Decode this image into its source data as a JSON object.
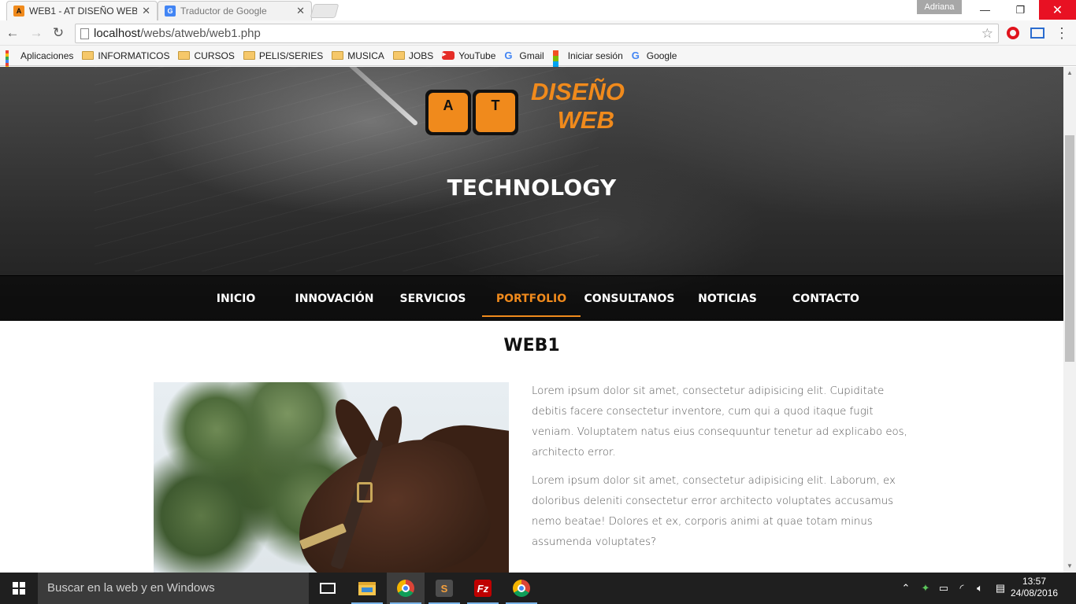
{
  "browser": {
    "tabs": [
      {
        "title": "WEB1 - AT DISEÑO WEB",
        "active": true
      },
      {
        "title": "Traductor de Google",
        "active": false
      }
    ],
    "profile_name": "Adriana",
    "url_host": "localhost",
    "url_path": "/webs/atweb/web1.php",
    "bookmarks": [
      {
        "label": "Aplicaciones",
        "icon": "apps-icon"
      },
      {
        "label": "INFORMATICOS",
        "icon": "folder-icon"
      },
      {
        "label": "CURSOS",
        "icon": "folder-icon"
      },
      {
        "label": "PELIS/SERIES",
        "icon": "folder-icon"
      },
      {
        "label": "MUSICA",
        "icon": "folder-icon"
      },
      {
        "label": "JOBS",
        "icon": "folder-icon"
      },
      {
        "label": "YouTube",
        "icon": "youtube-icon"
      },
      {
        "label": "Gmail",
        "icon": "google-icon"
      },
      {
        "label": "Iniciar sesión",
        "icon": "microsoft-icon"
      },
      {
        "label": "Google",
        "icon": "google-icon"
      }
    ]
  },
  "site": {
    "logo_key_a": "A",
    "logo_key_t": "T",
    "logo_line1": "DISEÑO",
    "logo_line2": "WEB",
    "hero_title": "TECHNOLOGY",
    "nav": [
      {
        "label": "INICIO",
        "active": false
      },
      {
        "label": "INNOVACIÓN",
        "active": false
      },
      {
        "label": "SERVICIOS",
        "active": false
      },
      {
        "label": "PORTFOLIO",
        "active": true
      },
      {
        "label": "CONSULTANOS",
        "active": false
      },
      {
        "label": "NOTICIAS",
        "active": false
      },
      {
        "label": "CONTACTO",
        "active": false
      }
    ],
    "page_title": "WEB1",
    "paragraphs": [
      "Lorem ipsum dolor sit amet, consectetur adipisicing elit. Cupiditate debitis facere consectetur inventore, cum qui a quod itaque fugit veniam. Voluptatem natus eius consequuntur tenetur ad explicabo eos, architecto error.",
      "Lorem ipsum dolor sit amet, consectetur adipisicing elit. Laborum, ex doloribus deleniti consectetur error architecto voluptates accusamus nemo beatae! Dolores et ex, corporis animi at quae totam minus assumenda voluptates?"
    ],
    "colors": {
      "accent": "#f08a1c",
      "hero_bg": "#2d2d2d",
      "text": "#555555"
    }
  },
  "taskbar": {
    "search_placeholder": "Buscar en la web y en Windows",
    "time": "13:57",
    "date": "24/08/2016"
  }
}
